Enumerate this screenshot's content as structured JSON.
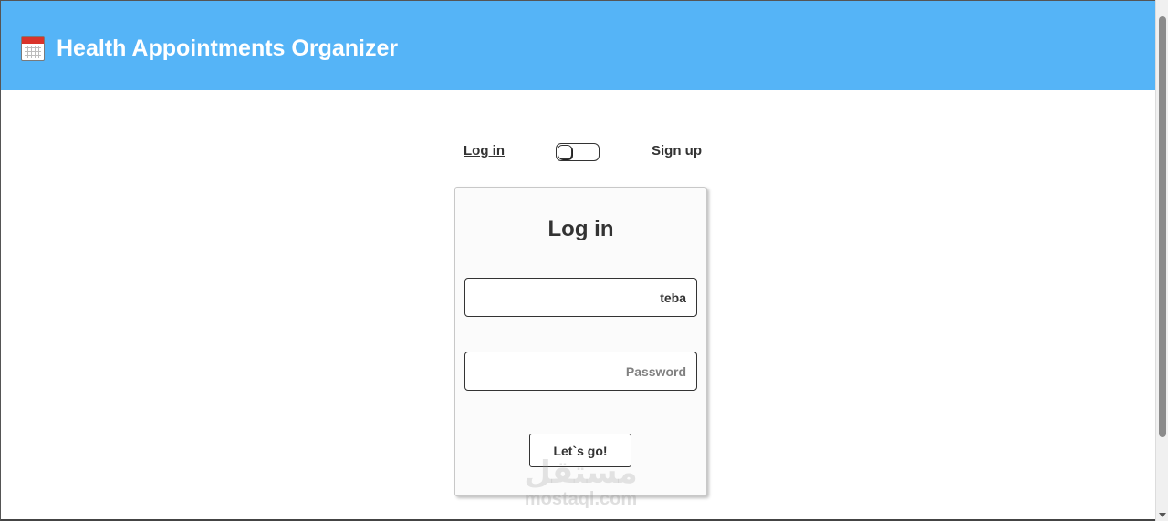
{
  "header": {
    "icon": "calendar-icon",
    "title": "Health Appointments Organizer",
    "background": "#55b4f7"
  },
  "mode_switch": {
    "login_label": "Log in",
    "signup_label": "Sign up",
    "toggle_state": "login"
  },
  "login_form": {
    "title": "Log in",
    "username_value": "teba",
    "password_placeholder": "Password",
    "submit_label": "Let`s go!"
  },
  "watermark": {
    "logo_text": "مستقل",
    "url": "mostaql.com"
  }
}
